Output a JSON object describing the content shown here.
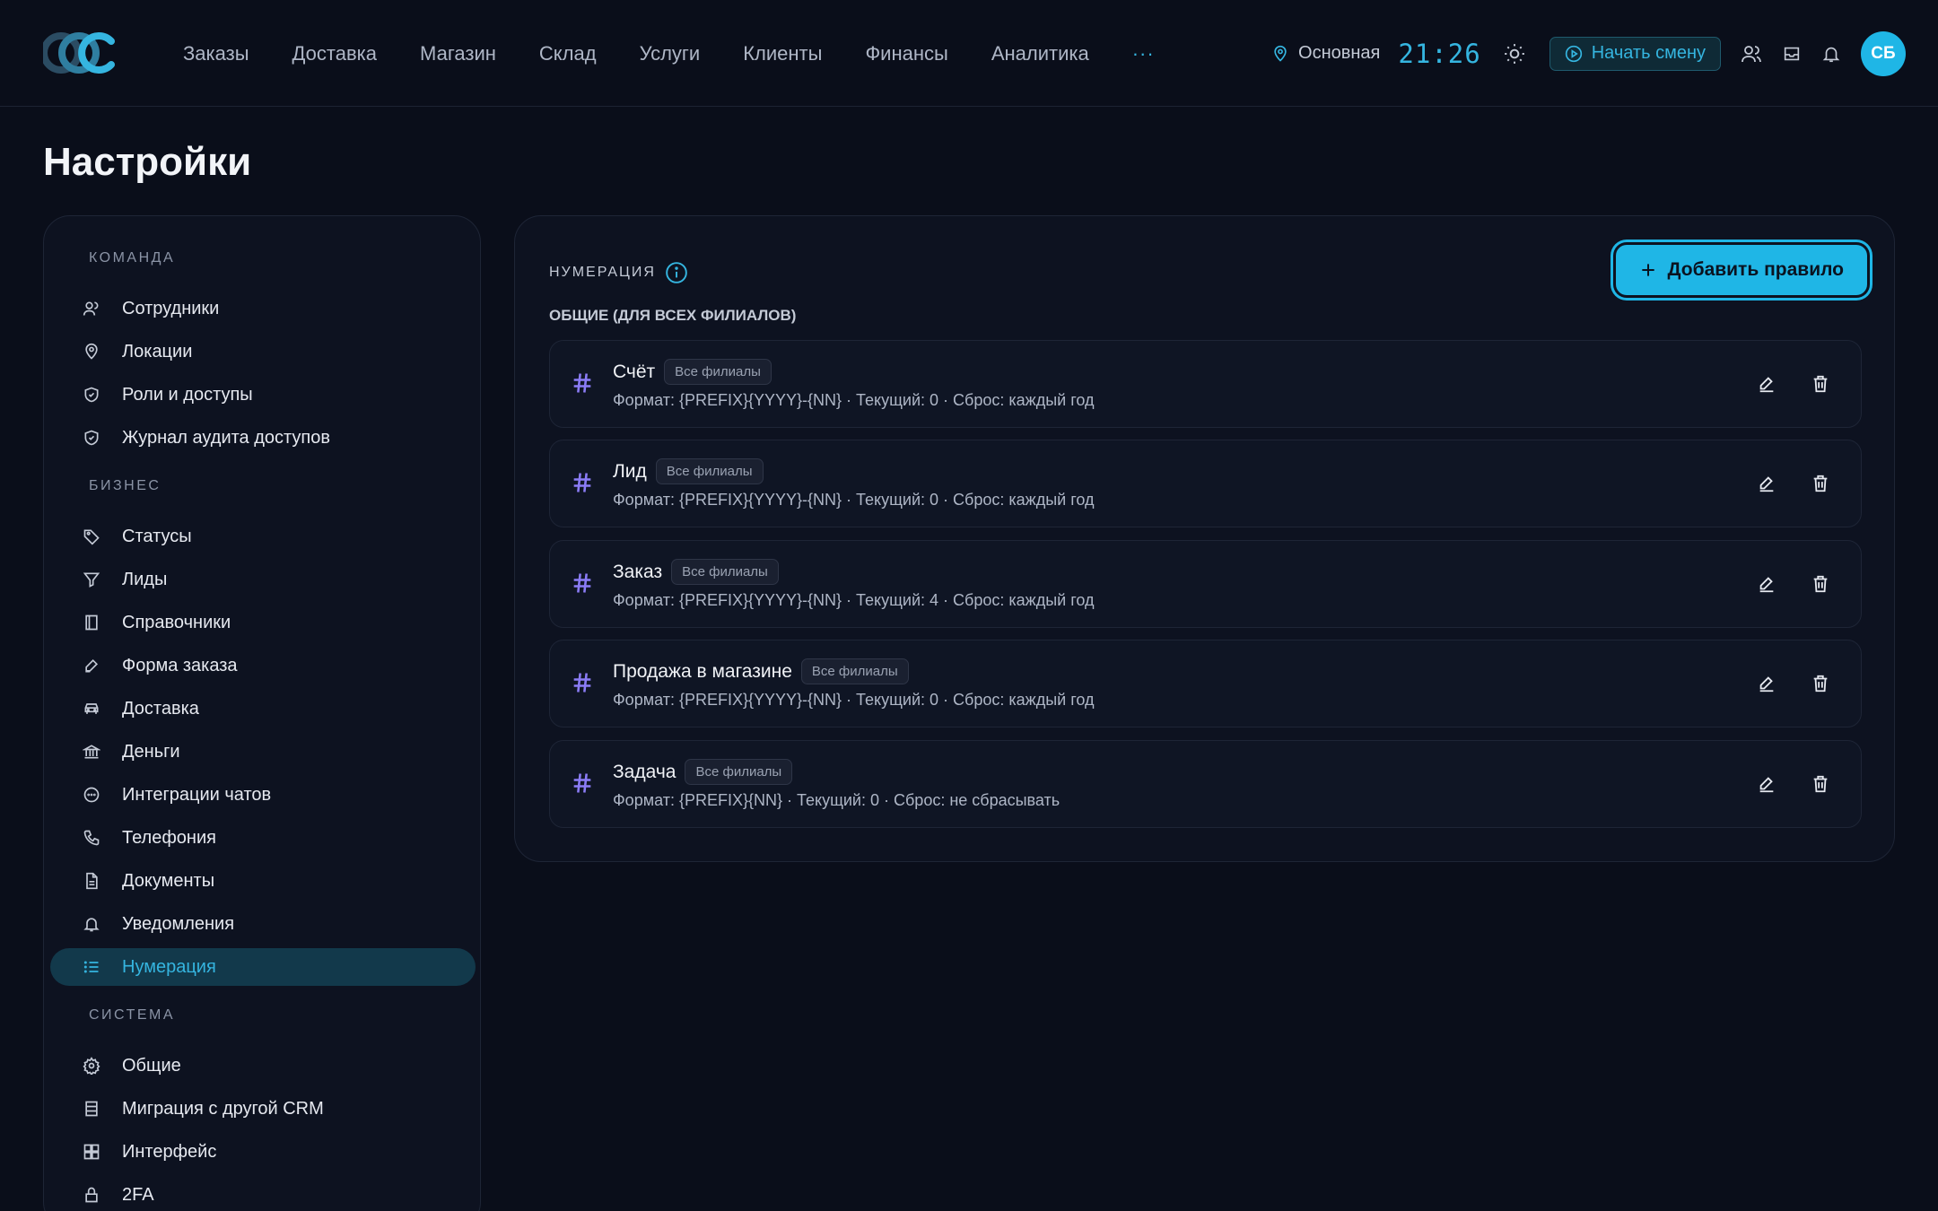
{
  "header": {
    "nav": [
      "Заказы",
      "Доставка",
      "Магазин",
      "Склад",
      "Услуги",
      "Клиенты",
      "Финансы",
      "Аналитика"
    ],
    "more": "···",
    "branch": "Основная",
    "time": "21:26",
    "shift_button": "Начать смену",
    "avatar_initials": "СБ"
  },
  "page": {
    "title": "Настройки"
  },
  "sidebar": {
    "sections": [
      {
        "label": "КОМАНДА",
        "items": [
          {
            "label": "Сотрудники",
            "icon": "users-icon"
          },
          {
            "label": "Локации",
            "icon": "map-pin-icon"
          },
          {
            "label": "Роли и доступы",
            "icon": "shield-check-icon"
          },
          {
            "label": "Журнал аудита доступов",
            "icon": "shield-check-icon"
          }
        ]
      },
      {
        "label": "БИЗНЕС",
        "items": [
          {
            "label": "Статусы",
            "icon": "tag-icon"
          },
          {
            "label": "Лиды",
            "icon": "funnel-icon"
          },
          {
            "label": "Справочники",
            "icon": "book-icon"
          },
          {
            "label": "Форма заказа",
            "icon": "pencil-icon"
          },
          {
            "label": "Доставка",
            "icon": "car-icon"
          },
          {
            "label": "Деньги",
            "icon": "bank-icon"
          },
          {
            "label": "Интеграции чатов",
            "icon": "chat-icon"
          },
          {
            "label": "Телефония",
            "icon": "phone-icon"
          },
          {
            "label": "Документы",
            "icon": "document-icon"
          },
          {
            "label": "Уведомления",
            "icon": "bell-icon"
          },
          {
            "label": "Нумерация",
            "icon": "list-icon",
            "active": true
          }
        ]
      },
      {
        "label": "СИСТЕМА",
        "items": [
          {
            "label": "Общие",
            "icon": "gear-icon"
          },
          {
            "label": "Миграция с другой CRM",
            "icon": "database-icon"
          },
          {
            "label": "Интерфейс",
            "icon": "grid-icon"
          },
          {
            "label": "2FA",
            "icon": "lock-icon"
          }
        ]
      }
    ]
  },
  "panel": {
    "label": "НУМЕРАЦИЯ",
    "add_button": "Добавить правило",
    "group_label": "ОБЩИЕ (ДЛЯ ВСЕХ ФИЛИАЛОВ)",
    "rules": [
      {
        "name": "Счёт",
        "badge": "Все филиалы",
        "format": "Формат: {PREFIX}{YYYY}-{NN} · Текущий: 0 · Сброс: каждый год"
      },
      {
        "name": "Лид",
        "badge": "Все филиалы",
        "format": "Формат: {PREFIX}{YYYY}-{NN} · Текущий: 0 · Сброс: каждый год"
      },
      {
        "name": "Заказ",
        "badge": "Все филиалы",
        "format": "Формат: {PREFIX}{YYYY}-{NN} · Текущий: 4 · Сброс: каждый год"
      },
      {
        "name": "Продажа в магазине",
        "badge": "Все филиалы",
        "format": "Формат: {PREFIX}{YYYY}-{NN} · Текущий: 0 · Сброс: каждый год"
      },
      {
        "name": "Задача",
        "badge": "Все филиалы",
        "format": "Формат: {PREFIX}{NN} · Текущий: 0 · Сброс: не сбрасывать"
      }
    ]
  },
  "colors": {
    "accent": "#1fb6e6",
    "background": "#0a0e1a",
    "hash_icon": "#8b7cf6"
  }
}
